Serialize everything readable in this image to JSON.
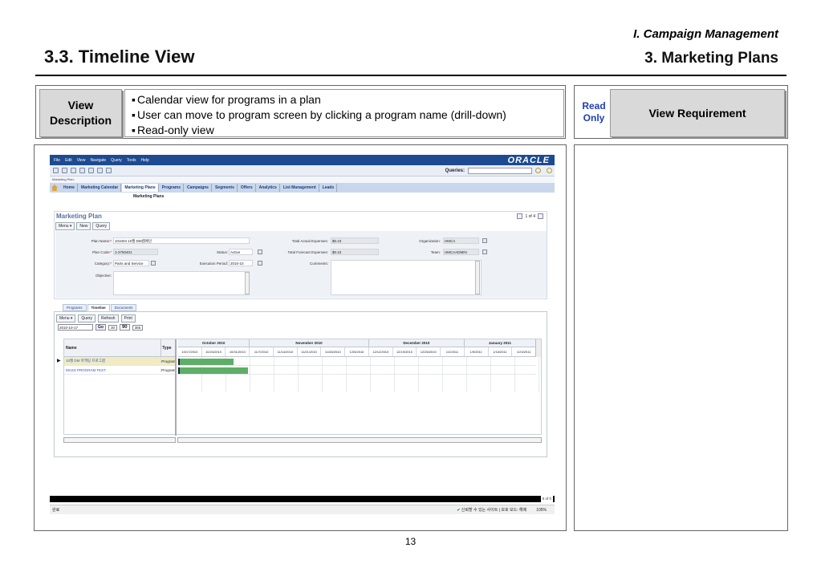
{
  "slide": {
    "section": "I. Campaign Management",
    "title": "3.3. Timeline View",
    "subsection": "3. Marketing Plans",
    "page_number": "13"
  },
  "description": {
    "label": "View Description",
    "items": [
      "Calendar view for programs in a plan",
      "User can move to program screen by clicking a program name (drill-down)",
      "Read-only view"
    ]
  },
  "requirement": {
    "tag": "Read Only",
    "label": "View Requirement"
  },
  "app": {
    "menu": [
      "File",
      "Edit",
      "View",
      "Navigate",
      "Query",
      "Tools",
      "Help"
    ],
    "logo": "ORACLE",
    "queries_label": "Queries:",
    "breadcrumb": "Marketing Plan:",
    "tabs": [
      "Home",
      "Marketing Calendar",
      "Marketing Plans",
      "Programs",
      "Campaigns",
      "Segments",
      "Offers",
      "Analytics",
      "List Management",
      "Leads"
    ],
    "active_tab": "Marketing Plans",
    "subtab": "Marketing Plans",
    "form": {
      "title": "Marketing Plan",
      "pager": "1 of 4",
      "buttons": [
        "Menu ▾",
        "New",
        "Query"
      ],
      "fields": {
        "plan_name_label": "Plan Name:",
        "plan_name": "101004 10월 DM캠페인",
        "plan_code_label": "Plan Code:",
        "plan_code": "1-2750401",
        "category_label": "Category:",
        "category": "Parts and Service",
        "objective_label": "Objective:",
        "status_label": "Status:",
        "status": "Active",
        "execution_period_label": "Execution Period:",
        "execution_period": "2010-10",
        "total_actual_label": "Total Actual Expenses:",
        "total_actual": "$0.10",
        "total_forecast_label": "Total Forecast Expenses:",
        "total_forecast": "$0.10",
        "comments_label": "Comments:",
        "organization_label": "Organization:",
        "organization": "HMCA",
        "team_label": "Team:",
        "team": "HMCAADMIN"
      }
    },
    "timeline": {
      "tabs": [
        "Programs",
        "Timeline",
        "Documents"
      ],
      "active_tab": "Timeline",
      "buttons": [
        "Menu ▾",
        "Query",
        "Refresh",
        "Print"
      ],
      "date": "2010-10-17",
      "go_label": "Go",
      "ranges": [
        "30",
        "90",
        "365"
      ],
      "selected_range": "90",
      "col_name": "Name",
      "col_type": "Type",
      "months": [
        {
          "label": "October 2010",
          "weeks": 3
        },
        {
          "label": "November 2010",
          "weeks": 5
        },
        {
          "label": "December 2010",
          "weeks": 4
        },
        {
          "label": "January 2011",
          "weeks": 3
        }
      ],
      "weeks": [
        "10/17/2010",
        "10/24/2010",
        "10/31/2010",
        "11/7/2010",
        "11/14/2010",
        "11/21/2010",
        "11/28/2010",
        "12/5/2010",
        "12/12/2010",
        "12/19/2010",
        "12/26/2010",
        "1/2/2011",
        "1/9/2011",
        "1/16/2011",
        "1/23/2011"
      ],
      "rows": [
        {
          "name": "10월 DM 마케팅 프로그램",
          "type": "Program",
          "selected": true,
          "bar_start_week": 0,
          "bar_weeks": 2.3
        },
        {
          "name": "MASS PROGRAM TEST",
          "type": "Program",
          "selected": false,
          "bar_start_week": 0,
          "bar_weeks": 2.9
        }
      ]
    },
    "scroll_label": "0 of 0",
    "status_left": "완료",
    "status_trusted": "신뢰할 수 있는 사이트 | 보호 모드: 해제",
    "status_zoom": "105%"
  }
}
